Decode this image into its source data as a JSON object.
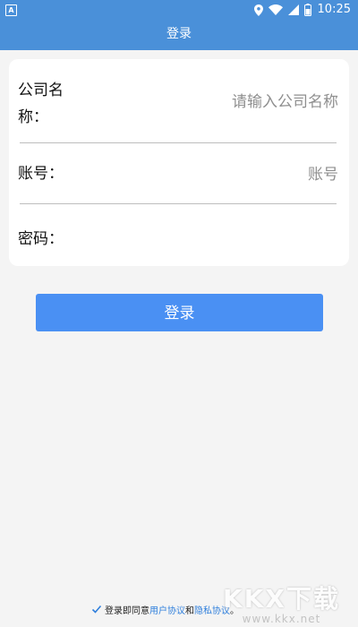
{
  "status_bar": {
    "app_badge": "A",
    "time": "10:25",
    "icons": [
      "location-icon",
      "wifi-icon",
      "signal-icon",
      "battery-icon"
    ]
  },
  "header": {
    "title": "登录"
  },
  "form": {
    "company": {
      "label": "公司名称：",
      "placeholder": "请输入公司名称",
      "value": ""
    },
    "account": {
      "label": "账号：",
      "placeholder": "账号",
      "value": ""
    },
    "password": {
      "label": "密码：",
      "placeholder": "",
      "value": ""
    }
  },
  "login_button": {
    "label": "登录"
  },
  "agreement": {
    "checked": true,
    "prefix": "登录即同意",
    "user_agreement": "用户协议",
    "and": "和",
    "privacy_policy": "隐私协议",
    "suffix": "。"
  },
  "watermark": {
    "brand": "KKX下载",
    "site": "www.kkx.net"
  },
  "colors": {
    "primary": "#4a90d9",
    "button": "#4a90f3",
    "link": "#2f7fdc",
    "background": "#f4f4f4"
  }
}
